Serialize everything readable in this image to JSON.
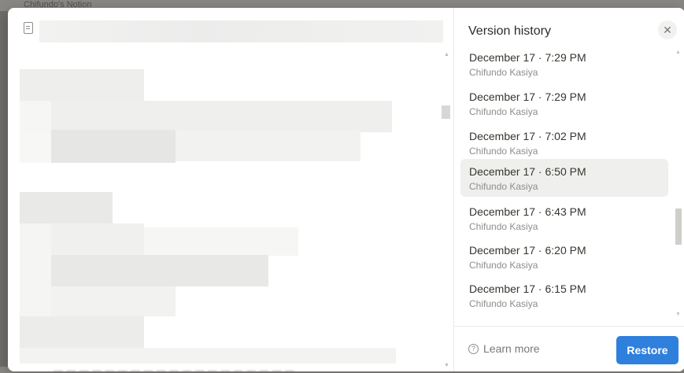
{
  "background": {
    "workspace_name": "Chifundo's Notion"
  },
  "panel": {
    "title": "Version history",
    "close_icon": "close-icon",
    "versions": [
      {
        "date": "December 17 · 7:29 PM",
        "author": "Chifundo Kasiya",
        "selected": false
      },
      {
        "date": "December 17 · 7:29 PM",
        "author": "Chifundo Kasiya",
        "selected": false
      },
      {
        "date": "December 17 · 7:02 PM",
        "author": "Chifundo Kasiya",
        "selected": false
      },
      {
        "date": "December 17 · 6:50 PM",
        "author": "Chifundo Kasiya",
        "selected": true
      },
      {
        "date": "December 17 · 6:43 PM",
        "author": "Chifundo Kasiya",
        "selected": false
      },
      {
        "date": "December 17 · 6:20 PM",
        "author": "Chifundo Kasiya",
        "selected": false
      },
      {
        "date": "December 17 · 6:15 PM",
        "author": "Chifundo Kasiya",
        "selected": false
      }
    ],
    "footer": {
      "learn_more_label": "Learn more",
      "help_icon": "help-circle-icon",
      "restore_label": "Restore"
    }
  },
  "colors": {
    "accent": "#2f80dd",
    "selected_row": "#efefed"
  }
}
